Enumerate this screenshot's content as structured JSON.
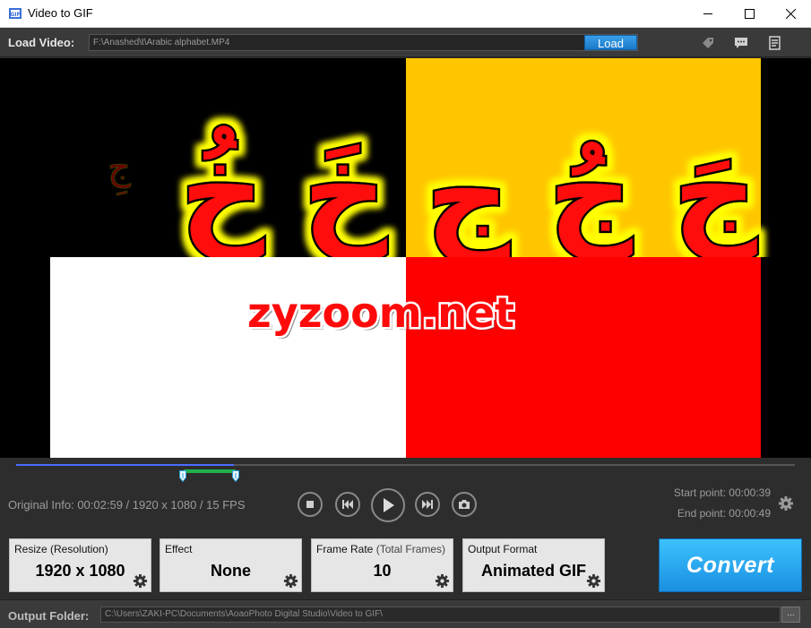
{
  "window": {
    "title": "Video to GIF"
  },
  "loadbar": {
    "label": "Load Video:",
    "path": "F:\\Anashed\\t\\Arabic alphabet.MP4",
    "load_label": "Load"
  },
  "preview": {
    "watermark": "zyzoom.net",
    "letters": [
      "خُ",
      "خَ",
      "جِ",
      "جُ",
      "جَ"
    ],
    "faded_letter": "جِ"
  },
  "timeline": {
    "progress": 0.28,
    "original_info": "Original Info: 00:02:59 / 1920 x 1080 / 15 FPS",
    "start_point": "Start point: 00:00:39",
    "end_point": "End point: 00:00:49"
  },
  "settings": {
    "resize": {
      "label": "Resize (Resolution)",
      "value": "1920 x 1080"
    },
    "effect": {
      "label": "Effect",
      "value": "None"
    },
    "frame_rate": {
      "label": "Frame Rate",
      "sublabel": "(Total Frames)",
      "value": "10"
    },
    "output_format": {
      "label": "Output Format",
      "value": "Animated GIF"
    },
    "convert_label": "Convert"
  },
  "output": {
    "label": "Output Folder:",
    "path": "C:\\Users\\ZAKI-PC\\Documents\\AoaoPhoto Digital Studio\\Video to GIF\\",
    "browse_label": "..."
  },
  "icons": {
    "app": "video-gif-app-icon",
    "tag": "tag-icon",
    "chat": "chat-icon",
    "list": "list-icon",
    "gear": "gear-icon"
  },
  "colors": {
    "accent": "#1a8fe0",
    "range": "#22b14c",
    "progress": "#4a6bff",
    "letter_fill": "#ff0a0a",
    "letter_glow": "#ffff00"
  }
}
